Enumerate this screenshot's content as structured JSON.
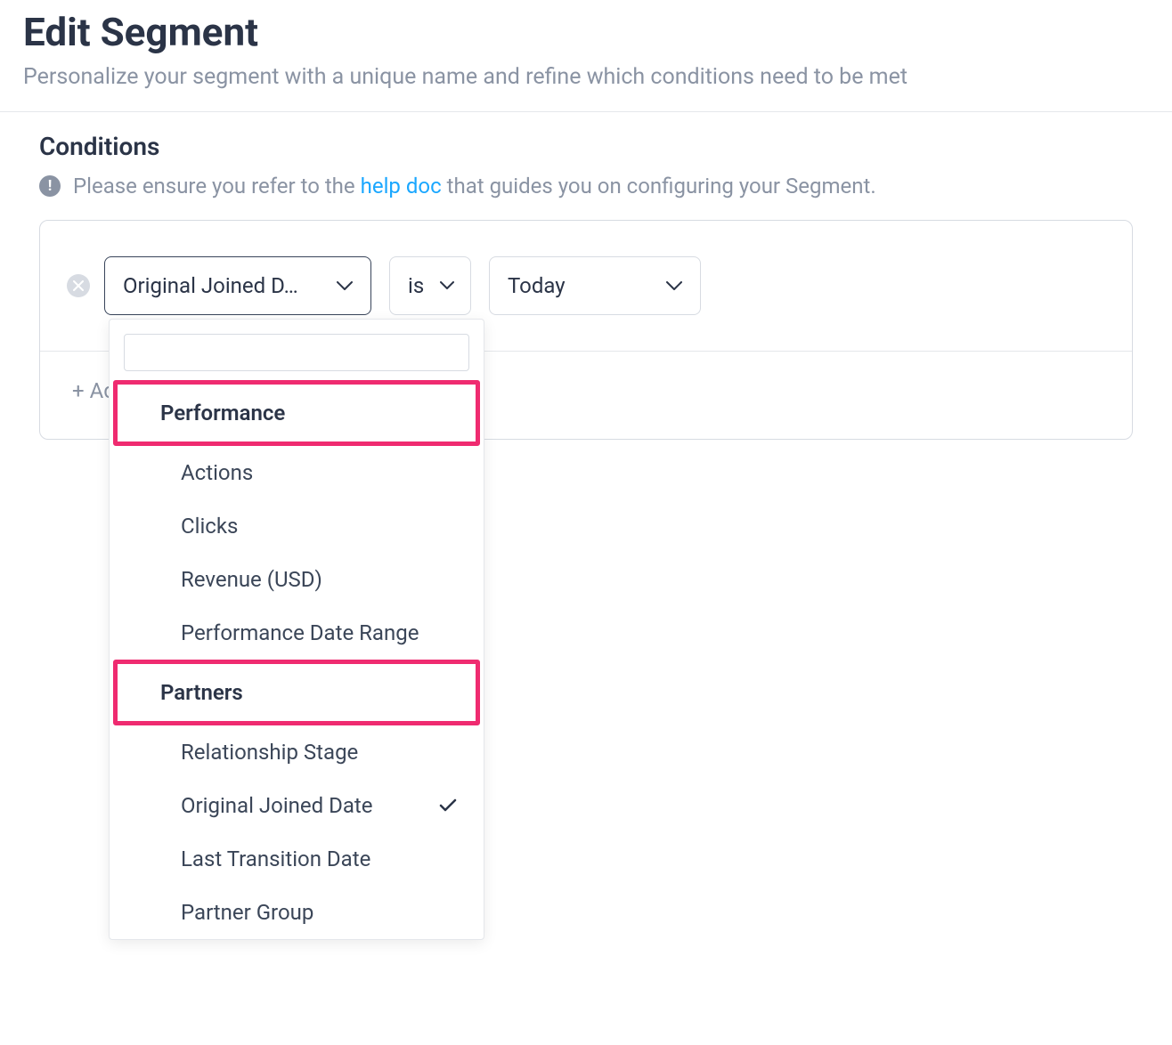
{
  "header": {
    "title": "Edit Segment",
    "subtitle": "Personalize your segment with a unique name and refine which conditions need to be met"
  },
  "conditions": {
    "section_title": "Conditions",
    "help_prefix": "Please ensure you refer to the",
    "help_link_text": "help doc",
    "help_suffix": "that guides you on configuring your Segment.",
    "row": {
      "field_select": "Original Joined D…",
      "operator_select": "is",
      "value_select": "Today"
    },
    "add_filter_label": "+ Add Filter"
  },
  "dropdown": {
    "search_placeholder": "",
    "group1": {
      "label": "Performance",
      "options": [
        "Actions",
        "Clicks",
        "Revenue (USD)",
        "Performance Date Range"
      ]
    },
    "group2": {
      "label": "Partners",
      "options": [
        "Relationship Stage",
        "Original Joined Date",
        "Last Transition Date",
        "Partner Group"
      ],
      "selected_index": 1
    }
  }
}
